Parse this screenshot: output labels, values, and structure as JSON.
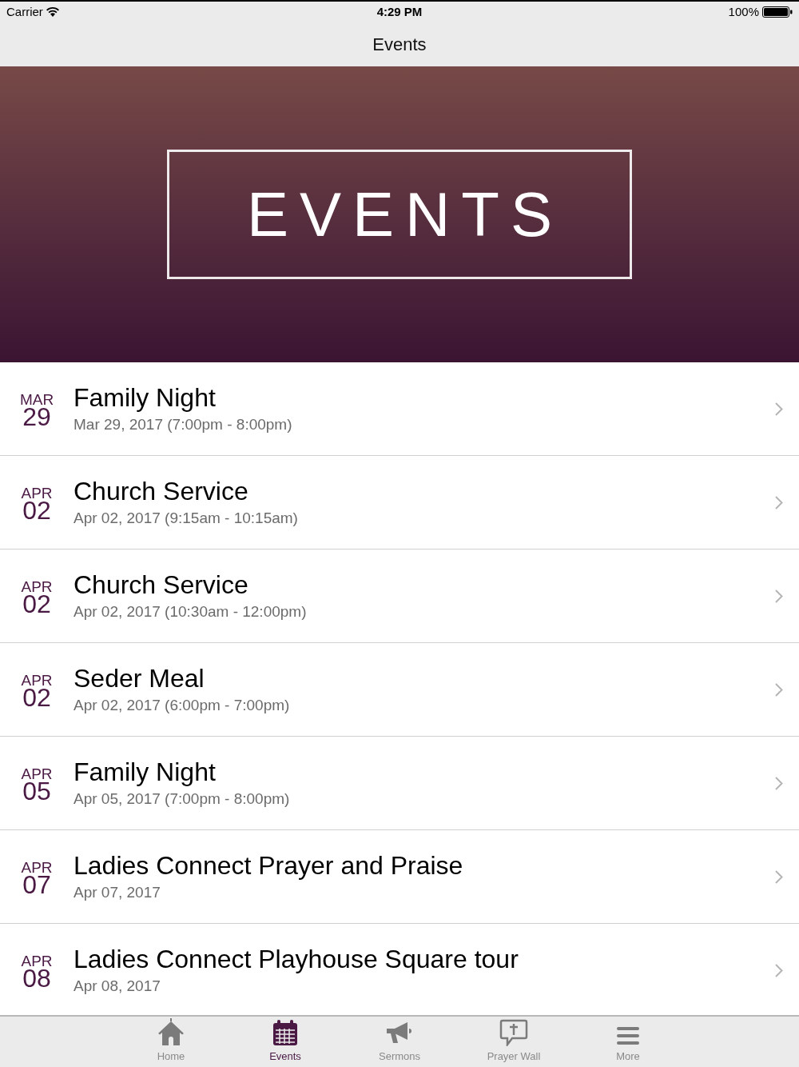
{
  "status_bar": {
    "carrier": "Carrier",
    "time": "4:29 PM",
    "battery": "100%"
  },
  "nav_bar": {
    "title": "Events"
  },
  "banner": {
    "title": "EVENTS"
  },
  "events": [
    {
      "month": "MAR",
      "day": "29",
      "title": "Family Night",
      "when": "Mar 29, 2017 (7:00pm - 8:00pm)"
    },
    {
      "month": "APR",
      "day": "02",
      "title": "Church Service",
      "when": "Apr 02, 2017 (9:15am - 10:15am)"
    },
    {
      "month": "APR",
      "day": "02",
      "title": "Church Service",
      "when": "Apr 02, 2017 (10:30am - 12:00pm)"
    },
    {
      "month": "APR",
      "day": "02",
      "title": "Seder Meal",
      "when": "Apr 02, 2017 (6:00pm - 7:00pm)"
    },
    {
      "month": "APR",
      "day": "05",
      "title": "Family Night",
      "when": "Apr 05, 2017 (7:00pm - 8:00pm)"
    },
    {
      "month": "APR",
      "day": "07",
      "title": "Ladies Connect Prayer and Praise",
      "when": "Apr 07, 2017"
    },
    {
      "month": "APR",
      "day": "08",
      "title": "Ladies Connect Playhouse Square tour",
      "when": "Apr 08, 2017"
    }
  ],
  "tab_bar": [
    {
      "kind": "home",
      "label": "Home",
      "selected": false
    },
    {
      "kind": "calendar",
      "label": "Events",
      "selected": true
    },
    {
      "kind": "megaphone",
      "label": "Sermons",
      "selected": false
    },
    {
      "kind": "prayer",
      "label": "Prayer Wall",
      "selected": false
    },
    {
      "kind": "menu",
      "label": "More",
      "selected": false
    }
  ]
}
